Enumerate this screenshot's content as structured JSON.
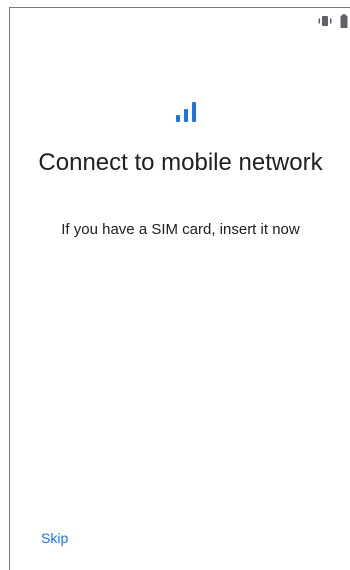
{
  "title": "Connect to mobile network",
  "subtitle": "If you have a SIM card, insert it now",
  "skip_label": "Skip",
  "icons": {
    "header": "signal-bars-icon",
    "status_bar": [
      "vibrate-icon",
      "battery-icon"
    ]
  },
  "colors": {
    "accent": "#1a73e8",
    "text": "#202124",
    "background": "#ffffff"
  }
}
